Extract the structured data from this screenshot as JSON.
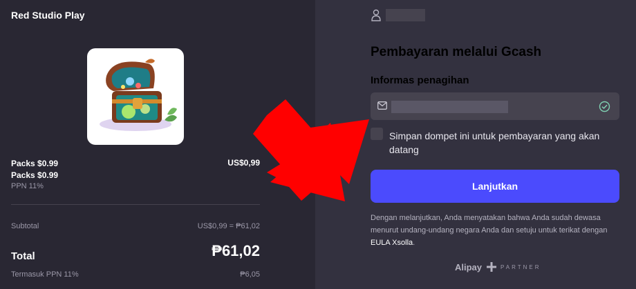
{
  "order": {
    "merchant": "Red Studio Play",
    "product_image_icon": "treasure-chest-icon",
    "item_name": "Packs $0.99",
    "item_price": "US$0,99",
    "item_subtitle": "Packs $0.99",
    "item_vat": "PPN 11%",
    "subtotal_label": "Subtotal",
    "subtotal_value": "US$0,99 = ₱61,02",
    "total_label": "Total",
    "total_value": "₱61,02",
    "vat_label": "Termasuk PPN 11%",
    "vat_value": "₱6,05"
  },
  "payment": {
    "title": "Pembayaran melalui Gcash",
    "billing_title": "Informas penagihan",
    "save_wallet_label": "Simpan dompet ini untuk pembayaran yang akan datang",
    "continue_label": "Lanjutkan",
    "legal_text": "Dengan melanjutkan, Anda menyatakan bahwa Anda sudah dewasa menurut undang-undang negara Anda dan setuju untuk terikat dengan ",
    "eula_link": "EULA Xsolla",
    "legal_end": ".",
    "partner_brand": "Alipay",
    "partner_label": "PARTNER"
  },
  "colors": {
    "accent": "#4b4bfd",
    "left_bg": "#292733",
    "right_bg": "#33313f",
    "annotation_arrow": "#ff0000",
    "valid_check": "#7fd1b2"
  }
}
